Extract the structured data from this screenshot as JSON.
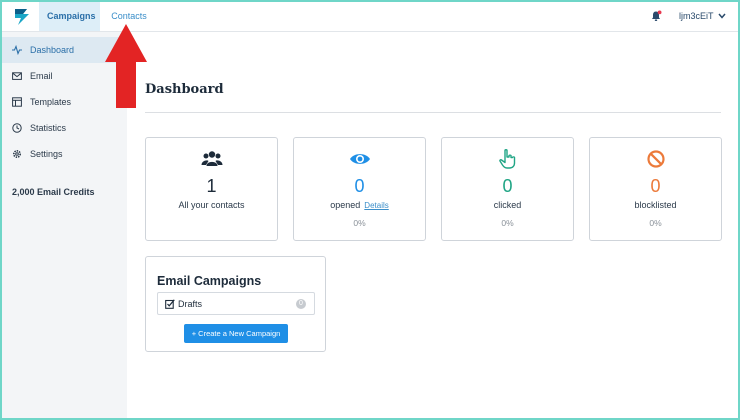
{
  "header": {
    "tabs": [
      {
        "label": "Campaigns",
        "active": true
      },
      {
        "label": "Contacts",
        "active": false
      }
    ],
    "username": "ljm3cEiT",
    "icons": [
      "logo-icon",
      "bell-icon",
      "chevron-down-icon"
    ]
  },
  "sidebar": {
    "items": [
      {
        "label": "Dashboard",
        "icon": "activity-icon",
        "active": true
      },
      {
        "label": "Email",
        "icon": "envelope-icon"
      },
      {
        "label": "Templates",
        "icon": "template-icon"
      },
      {
        "label": "Statistics",
        "icon": "clock-icon"
      },
      {
        "label": "Settings",
        "icon": "gear-icon"
      }
    ],
    "credits": "2,000 Email Credits"
  },
  "main": {
    "title": "Dashboard",
    "cards": [
      {
        "value": "1",
        "caption": "All your contacts",
        "icon": "users-icon",
        "color": "#1d2b3a"
      },
      {
        "value": "0",
        "caption": "opened",
        "link": "Details",
        "percent": "0%",
        "icon": "eye-icon",
        "color": "#1f8fe6"
      },
      {
        "value": "0",
        "caption": "clicked",
        "percent": "0%",
        "icon": "pointer-hand-icon",
        "color": "#20a585"
      },
      {
        "value": "0",
        "caption": "blocklisted",
        "percent": "0%",
        "icon": "ban-icon",
        "color": "#ec7a3a"
      }
    ],
    "campaigns": {
      "title": "Email Campaigns",
      "drafts_label": "Drafts",
      "drafts_count": "0",
      "create_button": "+ Create a New Campaign"
    }
  },
  "colors": {
    "accent": "#1f8fe6",
    "annotation_arrow": "#e32424"
  }
}
